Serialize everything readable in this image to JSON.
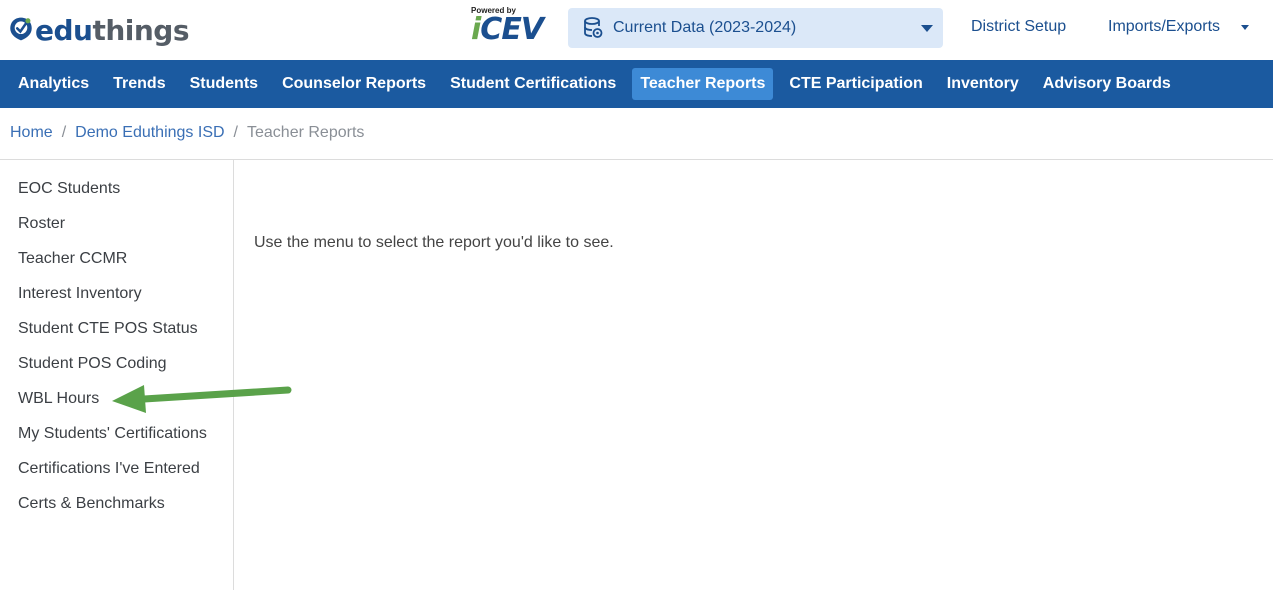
{
  "brand": {
    "logo_name_1": "edu",
    "logo_name_2": "things",
    "powered_by": "Powered by",
    "partner_logo_1": "i",
    "partner_logo_2": "CEV"
  },
  "data_selector": {
    "label": "Current Data (2023-2024)"
  },
  "top_links": {
    "district_setup": "District Setup",
    "imports_exports": "Imports/Exports"
  },
  "nav": {
    "items": [
      {
        "label": "Analytics",
        "active": false
      },
      {
        "label": "Trends",
        "active": false
      },
      {
        "label": "Students",
        "active": false
      },
      {
        "label": "Counselor Reports",
        "active": false
      },
      {
        "label": "Student Certifications",
        "active": false
      },
      {
        "label": "Teacher Reports",
        "active": true
      },
      {
        "label": "CTE Participation",
        "active": false
      },
      {
        "label": "Inventory",
        "active": false
      },
      {
        "label": "Advisory Boards",
        "active": false
      }
    ]
  },
  "breadcrumb": {
    "home": "Home",
    "district": "Demo Eduthings ISD",
    "current": "Teacher Reports",
    "separator": "/"
  },
  "sidebar": {
    "items": [
      {
        "label": "EOC Students"
      },
      {
        "label": "Roster"
      },
      {
        "label": "Teacher CCMR"
      },
      {
        "label": "Interest Inventory"
      },
      {
        "label": "Student CTE POS Status"
      },
      {
        "label": "Student POS Coding"
      },
      {
        "label": "WBL Hours"
      },
      {
        "label": "My Students' Certifications"
      },
      {
        "label": "Certifications I've Entered"
      },
      {
        "label": "Certs & Benchmarks"
      }
    ]
  },
  "main": {
    "message": "Use the menu to select the report you'd like to see."
  },
  "colors": {
    "brand_blue": "#1b5aa0",
    "active_tab": "#3d8ad6",
    "selector_bg": "#dbe8f8",
    "arrow_green": "#5aa24a"
  }
}
